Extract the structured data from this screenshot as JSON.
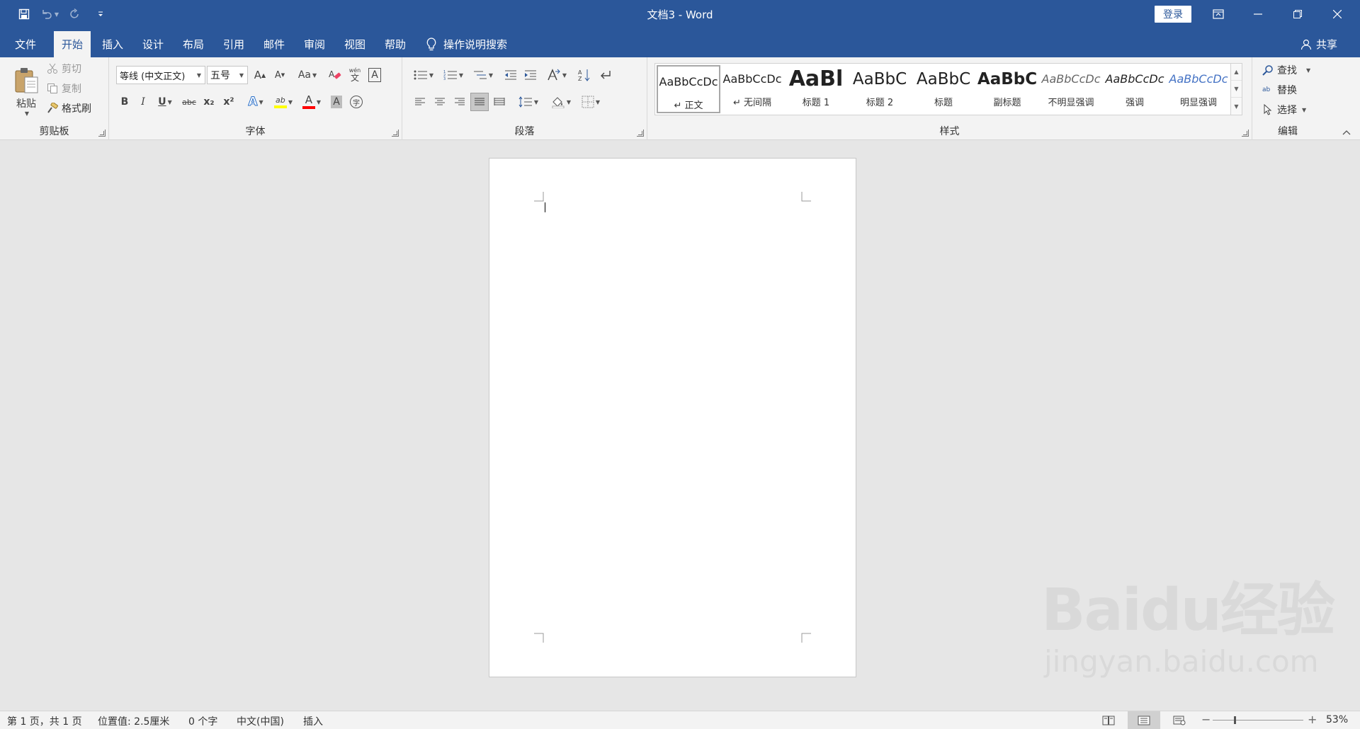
{
  "window": {
    "doc_title": "文档3 - Word",
    "login_label": "登录"
  },
  "tabs": [
    {
      "label": "文件"
    },
    {
      "label": "开始"
    },
    {
      "label": "插入"
    },
    {
      "label": "设计"
    },
    {
      "label": "布局"
    },
    {
      "label": "引用"
    },
    {
      "label": "邮件"
    },
    {
      "label": "审阅"
    },
    {
      "label": "视图"
    },
    {
      "label": "帮助"
    }
  ],
  "tellme": {
    "label": "操作说明搜索"
  },
  "share": {
    "label": "共享"
  },
  "clipboard": {
    "group_label": "剪贴板",
    "paste_label": "粘贴",
    "cut_label": "剪切",
    "copy_label": "复制",
    "format_painter_label": "格式刷"
  },
  "font": {
    "group_label": "字体",
    "font_name": "等线 (中文正文)",
    "font_size": "五号",
    "change_case_label": "Aa",
    "phonetic_label": "wén",
    "bold_label": "B",
    "italic_label": "I",
    "underline_label": "U",
    "strike_label": "abc",
    "sub_label": "x₂",
    "sup_label": "x²",
    "grow_label": "A",
    "shrink_label": "A",
    "border_char_label": "A",
    "effects_label": "A",
    "shading_label": "A",
    "font_color_label": "A",
    "highlight_label": "ab",
    "enclose_label": "字",
    "clear_label": "A"
  },
  "paragraph": {
    "group_label": "段落"
  },
  "styles": {
    "group_label": "样式",
    "items": [
      {
        "preview": "AaBbCcDc",
        "name": "正文"
      },
      {
        "preview": "AaBbCcDc",
        "name": "无间隔"
      },
      {
        "preview": "AaBl",
        "name": "标题 1"
      },
      {
        "preview": "AaBbC",
        "name": "标题 2"
      },
      {
        "preview": "AaBbC",
        "name": "标题"
      },
      {
        "preview": "AaBbC",
        "name": "副标题"
      },
      {
        "preview": "AaBbCcDc",
        "name": "不明显强调"
      },
      {
        "preview": "AaBbCcDc",
        "name": "强调"
      },
      {
        "preview": "AaBbCcDc",
        "name": "明显强调"
      }
    ]
  },
  "editing": {
    "group_label": "编辑",
    "find_label": "查找",
    "replace_label": "替换",
    "select_label": "选择",
    "replace_icon_text": "ab"
  },
  "statusbar": {
    "page": "第 1 页，共 1 页",
    "position": "位置值: 2.5厘米",
    "words": "0 个字",
    "language": "中文(中国)",
    "mode": "插入",
    "zoom": "53%",
    "zoom_minus": "−",
    "zoom_plus": "+"
  },
  "watermark": {
    "main": "Baidu经验",
    "sub": "jingyan.baidu.com"
  },
  "colors": {
    "accent": "#2b579a",
    "font_color_bar": "#ff0000",
    "highlight_bar": "#ffff00",
    "intense_emphasis": "#4472c4"
  }
}
